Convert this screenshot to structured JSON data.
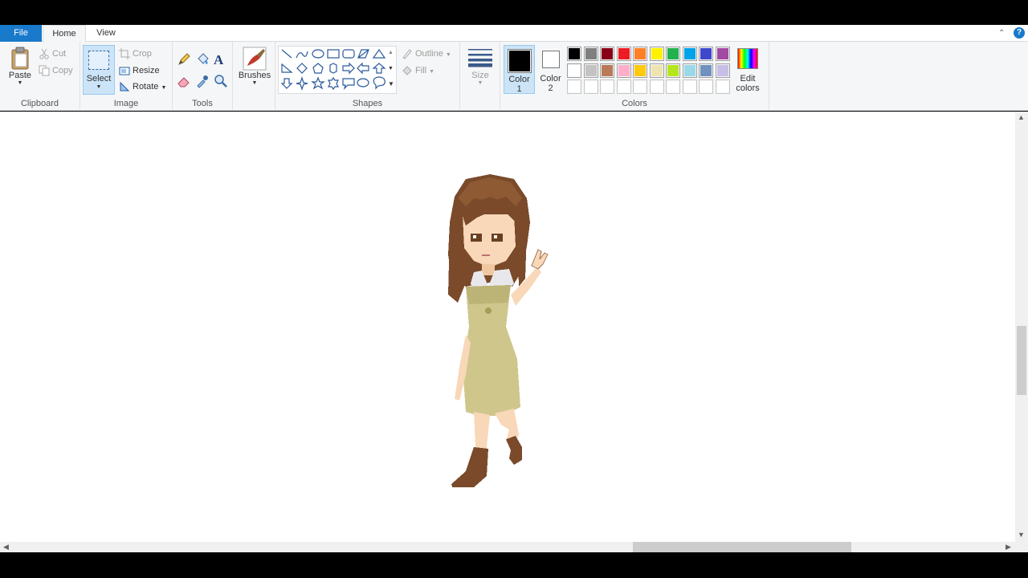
{
  "tabs": {
    "file": "File",
    "home": "Home",
    "view": "View"
  },
  "help": "?",
  "clipboard": {
    "paste": "Paste",
    "cut": "Cut",
    "copy": "Copy",
    "label": "Clipboard"
  },
  "image": {
    "select": "Select",
    "crop": "Crop",
    "resize": "Resize",
    "rotate": "Rotate",
    "label": "Image"
  },
  "tools": {
    "label": "Tools",
    "icons": [
      "pencil-icon",
      "fill-bucket-icon",
      "text-icon",
      "eraser-icon",
      "color-picker-icon",
      "magnifier-icon"
    ]
  },
  "brushes": {
    "label": "Brushes"
  },
  "shapes": {
    "label": "Shapes",
    "outline": "Outline",
    "fill": "Fill"
  },
  "size": {
    "label": "Size"
  },
  "colors": {
    "color1_label": "Color",
    "color1_num": "1",
    "color2_label": "Color",
    "color2_num": "2",
    "color1": "#000000",
    "color2": "#ffffff",
    "label": "Colors",
    "edit_line1": "Edit",
    "edit_line2": "colors",
    "palette_row1": [
      "#000000",
      "#7f7f7f",
      "#880015",
      "#ed1c24",
      "#ff7f27",
      "#fff200",
      "#22b14c",
      "#00a2e8",
      "#3f48cc",
      "#a349a4"
    ],
    "palette_row2": [
      "#ffffff",
      "#c3c3c3",
      "#b97a57",
      "#ffaec9",
      "#ffc90e",
      "#efe4b0",
      "#b5e61d",
      "#99d9ea",
      "#7092be",
      "#c8bfe7"
    ],
    "palette_row3": [
      "#ffffff",
      "#ffffff",
      "#ffffff",
      "#ffffff",
      "#ffffff",
      "#ffffff",
      "#ffffff",
      "#ffffff",
      "#ffffff",
      "#ffffff"
    ]
  },
  "canvas": {
    "image": "pixel-art-girl-character"
  }
}
